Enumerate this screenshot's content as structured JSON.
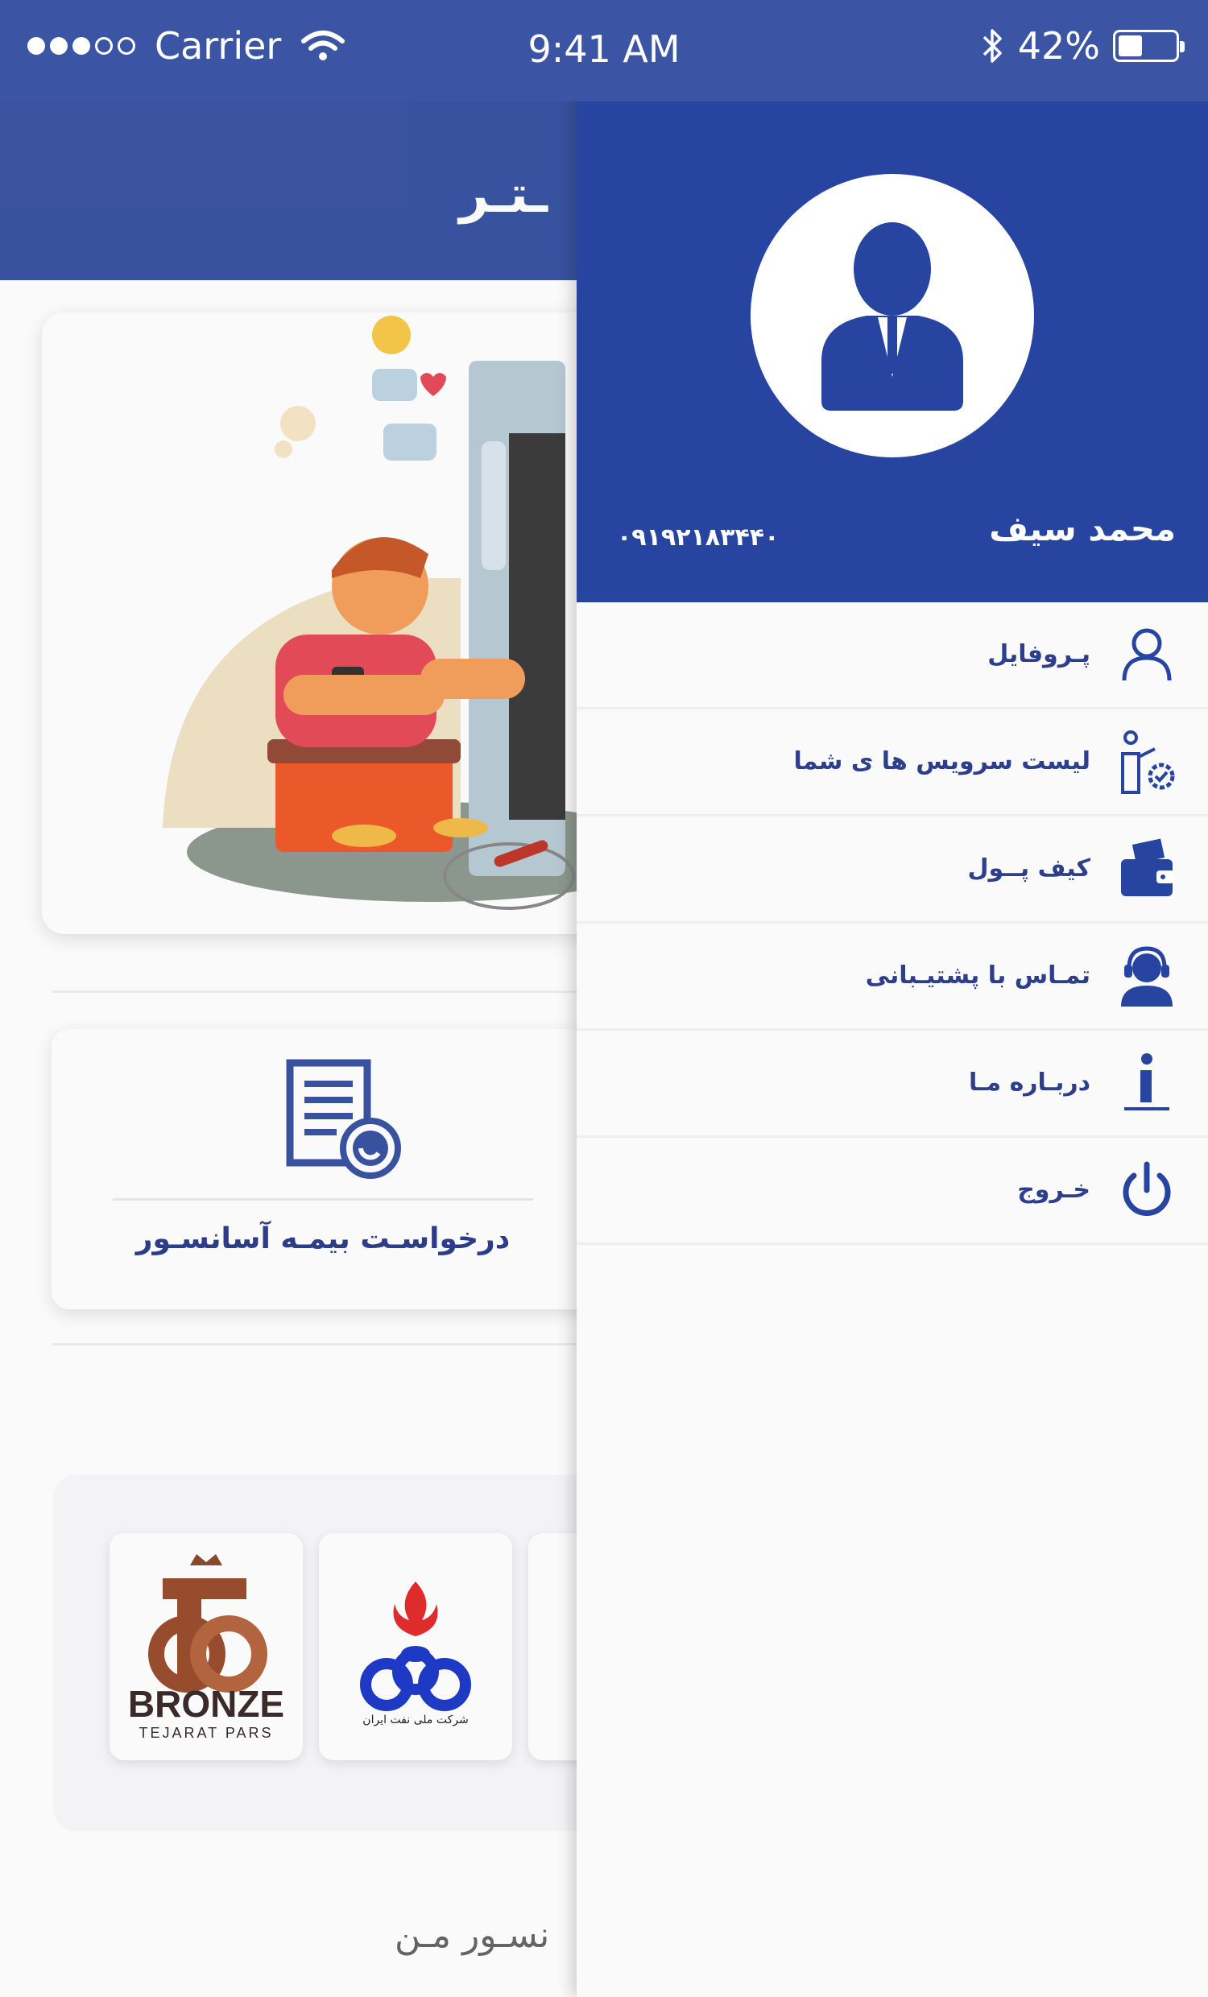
{
  "status_bar": {
    "carrier": "Carrier",
    "time": "9:41 AM",
    "battery": "42%",
    "battery_level": 0.42,
    "signal_bars_filled": 3,
    "signal_bars_total": 5
  },
  "header": {
    "title_visible_fragment": "ـتـر"
  },
  "main": {
    "service_card_label": "درخواسـت بیمـه آسانسـور",
    "partners": [
      {
        "name": "BRONZE",
        "subtitle": "TEJARAT PARS"
      },
      {
        "name": "شرکت ملی نفت ایران"
      }
    ],
    "bottom_tab_fragment": "نسـور مـن"
  },
  "drawer": {
    "user_name": "محمد سیف",
    "user_phone": "۰۹۱۹۲۱۸۳۴۴۰",
    "menu": [
      {
        "label": "پـروفایل",
        "icon": "user-icon"
      },
      {
        "label": "لیست سرویس ها ی شما",
        "icon": "service-list-icon"
      },
      {
        "label": "کیف پــول",
        "icon": "wallet-icon"
      },
      {
        "label": "تمـاس با پشتیـبانی",
        "icon": "support-icon"
      },
      {
        "label": "دربـاره مـا",
        "icon": "info-icon"
      },
      {
        "label": "خـروج",
        "icon": "power-icon"
      }
    ]
  },
  "colors": {
    "header_blue": "#3b54a3",
    "drawer_blue": "#2745a0",
    "menu_text": "#2d3e8c"
  }
}
